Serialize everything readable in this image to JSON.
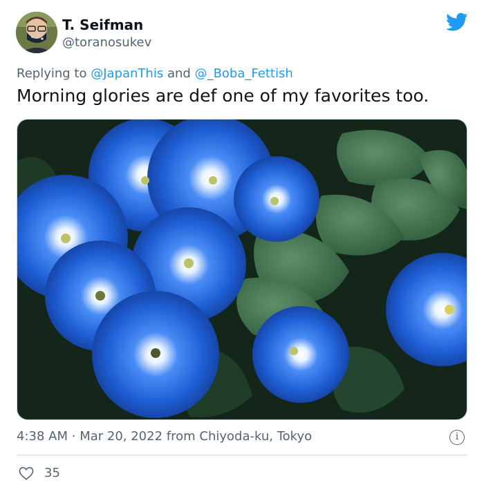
{
  "author": {
    "display_name": "T. Seifman",
    "handle": "@toranosukev",
    "avatar_icon": "user-avatar"
  },
  "reply": {
    "prefix": "Replying to",
    "mention1": "@JapanThis",
    "conjunction": "and",
    "mention2": "@_Boba_Fettish"
  },
  "tweet": {
    "text": "Morning glories are def one of my favorites too."
  },
  "media": {
    "subject": "blue morning glory flowers photo"
  },
  "meta": {
    "time": "4:38 AM",
    "separator": "·",
    "date": "Mar 20, 2022",
    "source": "from Chiyoda-ku, Tokyo"
  },
  "info_label": "i",
  "engagement": {
    "likes": "35",
    "like_icon": "heart-icon"
  },
  "colors": {
    "link": "#1d9bf0",
    "secondary_text": "#536471",
    "flower_blue": "#1f5fd6"
  }
}
